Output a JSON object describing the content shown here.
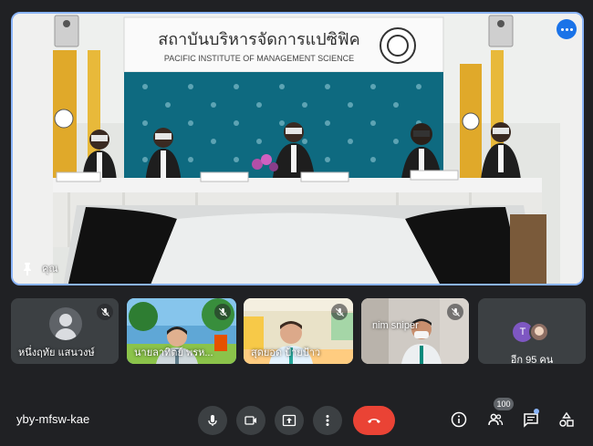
{
  "main_tile": {
    "name": "คุณ",
    "banner": {
      "thai": "สถาบันบริหารจัดการแปซิฟิค",
      "english": "PACIFIC INSTITUTE OF MANAGEMENT SCIENCE"
    }
  },
  "participants": [
    {
      "name": "หนึ่งฤทัย แสนวงษ์",
      "muted": true,
      "kind": "avatar"
    },
    {
      "name": "นายลาทิตย์ พรห...",
      "muted": true,
      "kind": "video"
    },
    {
      "name": "สุดยอด ป้ายป้าว",
      "muted": true,
      "kind": "video"
    },
    {
      "name": "nim sniper",
      "muted": true,
      "kind": "video"
    }
  ],
  "others": {
    "label": "อีก 95 คน",
    "initial": "T"
  },
  "meeting_code": "yby-mfsw-kae",
  "people_count": "100",
  "icons": {
    "pin": "pin-icon",
    "more": "more-options-icon",
    "mic": "mic-icon",
    "camera": "camera-icon",
    "present": "present-screen-icon",
    "more_vert": "more-vert-icon",
    "end_call": "end-call-icon",
    "info": "info-icon",
    "people": "people-icon",
    "chat": "chat-icon",
    "activities": "activities-icon"
  },
  "colors": {
    "accent": "#8ab4f8",
    "end_call": "#ea4335",
    "background": "#202124",
    "tile": "#3c4043"
  }
}
